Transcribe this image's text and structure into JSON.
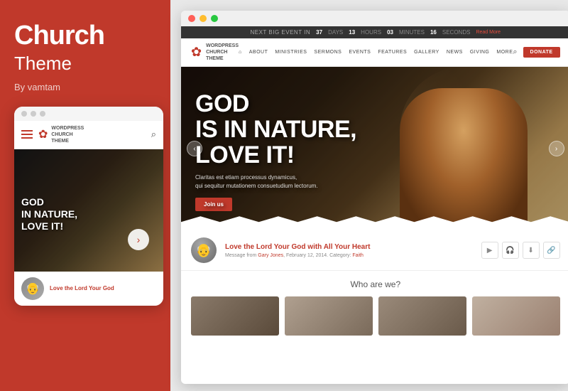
{
  "left": {
    "title": "Church",
    "subtitle": "Theme",
    "by": "By vamtam"
  },
  "mobile": {
    "dots": [
      "dot1",
      "dot2",
      "dot3"
    ],
    "logo": {
      "text": "WORDPRESS\nCHURCH\nTHEME"
    },
    "hero_text": "GOD\nIN NATURE,\nLOVE IT!",
    "sermon_text": "Love the Lord Your God"
  },
  "browser": {
    "dots": [
      "red",
      "yellow",
      "green"
    ]
  },
  "countdown": {
    "label": "NEXT BIG EVENT IN",
    "days": "37",
    "days_unit": "DAYS",
    "hours": "13",
    "hours_unit": "HOURS",
    "minutes": "03",
    "minutes_unit": "MINUTES",
    "seconds": "16",
    "seconds_unit": "SECONDS",
    "read_more": "Read More"
  },
  "nav": {
    "logo_text": "WORDPRESS\nCHURCH\nTHEME",
    "links": [
      "ABOUT",
      "MINISTRIES",
      "SERMONS",
      "EVENTS",
      "FEATURES",
      "GALLERY",
      "NEWS",
      "GIVING",
      "MORE"
    ],
    "donate": "Donate"
  },
  "hero": {
    "heading_line1": "GOD",
    "heading_line2": "IS IN NATURE,",
    "heading_line3": "LOVE IT!",
    "subtext": "Claritas est etiam processus dynamicus,\nqui sequitur mutationem consuetudium lectorum.",
    "join_btn": "Join us"
  },
  "sermon": {
    "title": "Love the Lord Your God with All Your Heart",
    "meta": "Message from Gary Jones, February 12, 2014. Category: Faith",
    "actions": [
      "▶",
      "🎧",
      "⬇",
      "🔗"
    ]
  },
  "who": {
    "title": "Who are we?",
    "cards": [
      "church-interior",
      "hands",
      "people",
      "woman"
    ]
  }
}
